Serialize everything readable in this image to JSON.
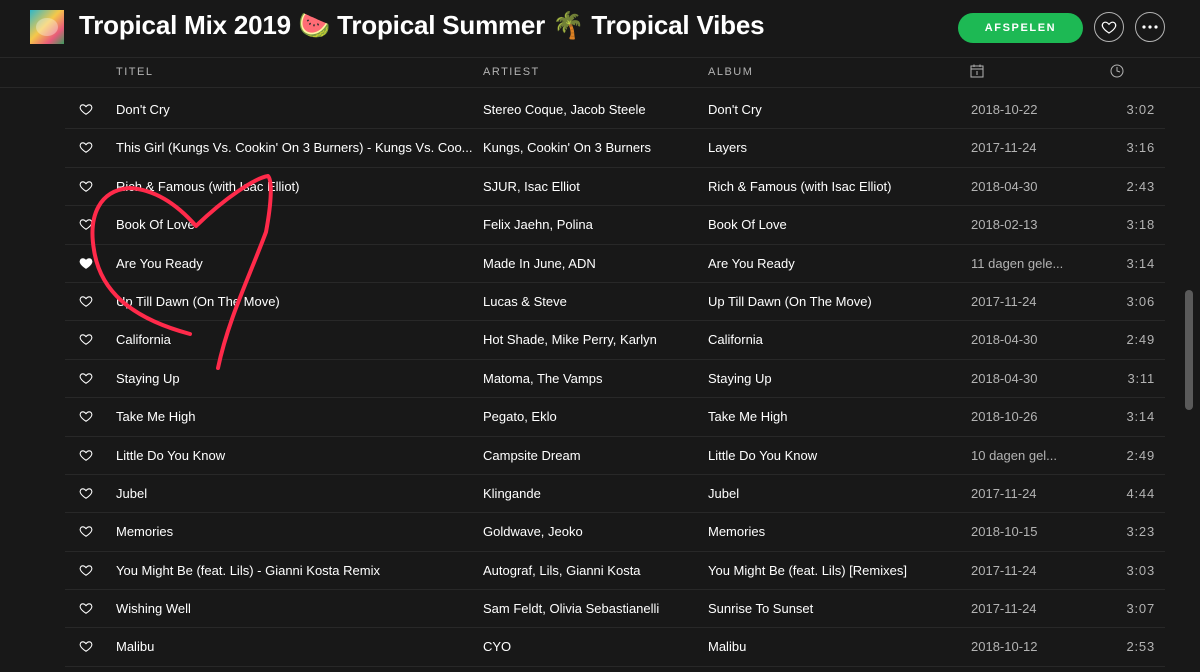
{
  "header": {
    "title": "Tropical Mix 2019 🍉 Tropical Summer 🌴 Tropical Vibes",
    "play_label": "AFSPELEN"
  },
  "columns": {
    "title": "TITEL",
    "artist": "ARTIEST",
    "album": "ALBUM"
  },
  "icons": {
    "heart": "heart-icon",
    "more": "more-icon",
    "calendar": "calendar-icon",
    "clock": "clock-icon"
  },
  "colors": {
    "accent": "#1db954",
    "background": "#181818",
    "annotation": "#ff2a4a"
  },
  "tracks": [
    {
      "title": "Don't Cry",
      "artist": "Stereo Coque, Jacob Steele",
      "album": "Don't Cry",
      "date": "2018-10-22",
      "duration": "3:02",
      "liked": false
    },
    {
      "title": "This Girl (Kungs Vs. Cookin' On 3 Burners) - Kungs Vs. Coo...",
      "artist": "Kungs, Cookin' On 3 Burners",
      "album": "Layers",
      "date": "2017-11-24",
      "duration": "3:16",
      "liked": false
    },
    {
      "title": "Rich & Famous (with Isac Elliot)",
      "artist": "SJUR, Isac Elliot",
      "album": "Rich & Famous (with Isac Elliot)",
      "date": "2018-04-30",
      "duration": "2:43",
      "liked": false
    },
    {
      "title": "Book Of Love",
      "artist": "Felix Jaehn, Polina",
      "album": "Book Of Love",
      "date": "2018-02-13",
      "duration": "3:18",
      "liked": false
    },
    {
      "title": "Are You Ready",
      "artist": "Made In June, ADN",
      "album": "Are You Ready",
      "date": "11 dagen gele...",
      "duration": "3:14",
      "liked": true
    },
    {
      "title": "Up Till Dawn (On The Move)",
      "artist": "Lucas & Steve",
      "album": "Up Till Dawn (On The Move)",
      "date": "2017-11-24",
      "duration": "3:06",
      "liked": false
    },
    {
      "title": "California",
      "artist": "Hot Shade, Mike Perry, Karlyn",
      "album": "California",
      "date": "2018-04-30",
      "duration": "2:49",
      "liked": false
    },
    {
      "title": "Staying Up",
      "artist": "Matoma, The Vamps",
      "album": "Staying Up",
      "date": "2018-04-30",
      "duration": "3:11",
      "liked": false
    },
    {
      "title": "Take Me High",
      "artist": "Pegato, Eklo",
      "album": "Take Me High",
      "date": "2018-10-26",
      "duration": "3:14",
      "liked": false
    },
    {
      "title": "Little Do You Know",
      "artist": "Campsite Dream",
      "album": "Little Do You Know",
      "date": "10 dagen gel...",
      "duration": "2:49",
      "liked": false
    },
    {
      "title": "Jubel",
      "artist": "Klingande",
      "album": "Jubel",
      "date": "2017-11-24",
      "duration": "4:44",
      "liked": false
    },
    {
      "title": "Memories",
      "artist": "Goldwave, Jeoko",
      "album": "Memories",
      "date": "2018-10-15",
      "duration": "3:23",
      "liked": false
    },
    {
      "title": "You Might Be (feat. Lils) - Gianni Kosta Remix",
      "artist": "Autograf, Lils, Gianni Kosta",
      "album": "You Might Be (feat. Lils) [Remixes]",
      "date": "2017-11-24",
      "duration": "3:03",
      "liked": false
    },
    {
      "title": "Wishing Well",
      "artist": "Sam Feldt, Olivia Sebastianelli",
      "album": "Sunrise To Sunset",
      "date": "2017-11-24",
      "duration": "3:07",
      "liked": false
    },
    {
      "title": "Malibu",
      "artist": "CYO",
      "album": "Malibu",
      "date": "2018-10-12",
      "duration": "2:53",
      "liked": false
    }
  ]
}
